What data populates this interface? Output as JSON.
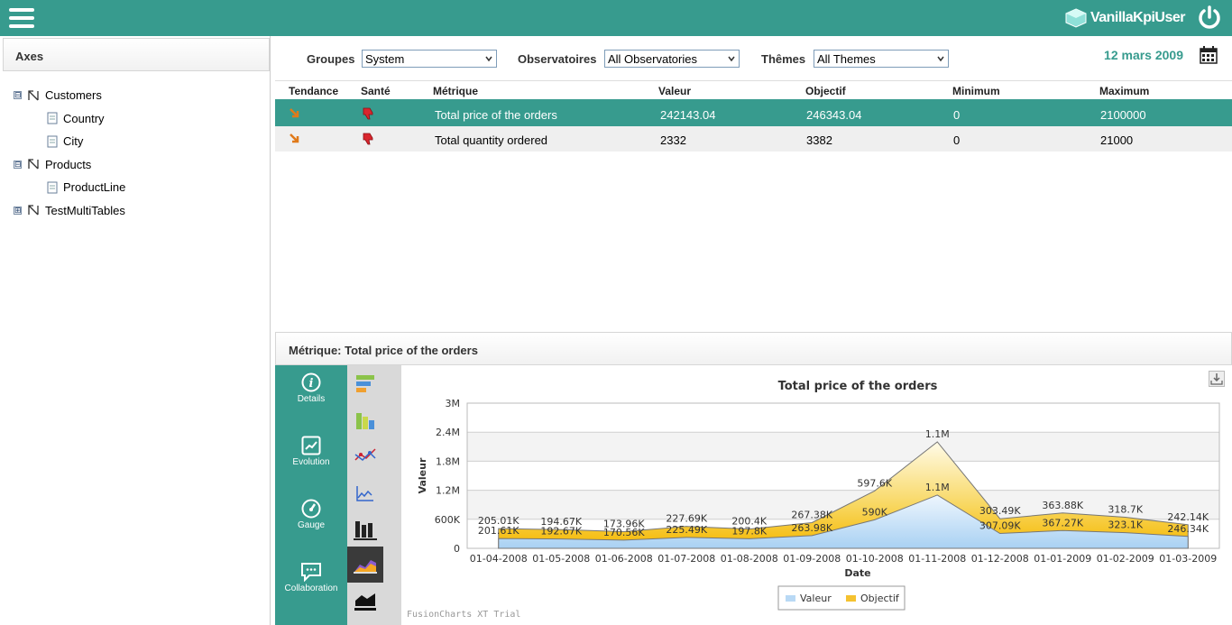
{
  "header": {
    "brand": "VanillaKpiUser"
  },
  "sidebar": {
    "title": "Axes",
    "tree": [
      {
        "label": "Customers",
        "toggle": "⊟",
        "type": "dim"
      },
      {
        "label": "Country",
        "type": "leaf"
      },
      {
        "label": "City",
        "type": "leaf"
      },
      {
        "label": "Products",
        "toggle": "⊟",
        "type": "dim"
      },
      {
        "label": "ProductLine",
        "type": "leaf"
      },
      {
        "label": "TestMultiTables",
        "toggle": "⊞",
        "type": "dim"
      }
    ]
  },
  "filters": {
    "groupes_label": "Groupes",
    "groupes_value": "System",
    "observatoires_label": "Observatoires",
    "observatoires_value": "All Observatories",
    "themes_label": "Thêmes",
    "themes_value": "All Themes",
    "date": "12 mars 2009"
  },
  "table": {
    "headers": [
      "Tendance",
      "Santé",
      "Métrique",
      "Valeur",
      "Objectif",
      "Minimum",
      "Maximum"
    ],
    "rows": [
      {
        "metric": "Total price of the orders",
        "valeur": "242143.04",
        "objectif": "246343.04",
        "minimum": "0",
        "maximum": "2100000"
      },
      {
        "metric": "Total quantity ordered",
        "valeur": "2332",
        "objectif": "3382",
        "minimum": "0",
        "maximum": "21000"
      }
    ]
  },
  "metric_panel": {
    "title": "Métrique: Total price of the orders"
  },
  "nav": {
    "details": "Details",
    "evolution": "Evolution",
    "gauge": "Gauge",
    "collaboration": "Collaboration"
  },
  "colors": {
    "accent": "#379b8e",
    "valeur_fill": "#b9d9f5",
    "objectif_fill": "#f5c230"
  },
  "chart_data": {
    "type": "area",
    "title": "Total price of the orders",
    "xlabel": "Date",
    "ylabel": "Valeur",
    "ylim": [
      0,
      3000000
    ],
    "yticks": [
      "0",
      "600K",
      "1.2M",
      "1.8M",
      "2.4M",
      "3M"
    ],
    "categories": [
      "01-04-2008",
      "01-05-2008",
      "01-06-2008",
      "01-07-2008",
      "01-08-2008",
      "01-09-2008",
      "01-10-2008",
      "01-11-2008",
      "01-12-2008",
      "01-01-2009",
      "01-02-2009",
      "01-03-2009"
    ],
    "series": [
      {
        "name": "Valeur",
        "values": [
          201610,
          192670,
          170560,
          225490,
          197800,
          263980,
          590000,
          1100000,
          307090,
          367270,
          323100,
          246340
        ],
        "labels": [
          "201.61K",
          "192.67K",
          "170.56K",
          "225.49K",
          "197.8K",
          "263.98K",
          "590K",
          "1.1M",
          "307.09K",
          "367.27K",
          "323.1K",
          "246.34K"
        ]
      },
      {
        "name": "Objectif",
        "values": [
          205010,
          194670,
          173960,
          227690,
          200400,
          267380,
          597600,
          1100000,
          303490,
          363880,
          318700,
          242140
        ],
        "labels": [
          "205.01K",
          "194.67K",
          "173.96K",
          "227.69K",
          "200.4K",
          "267.38K",
          "597.6K",
          "1.1M",
          "303.49K",
          "363.88K",
          "318.7K",
          "242.14K"
        ]
      }
    ],
    "legend": "bottom",
    "grid": true,
    "watermark": "FusionCharts XT Trial"
  }
}
